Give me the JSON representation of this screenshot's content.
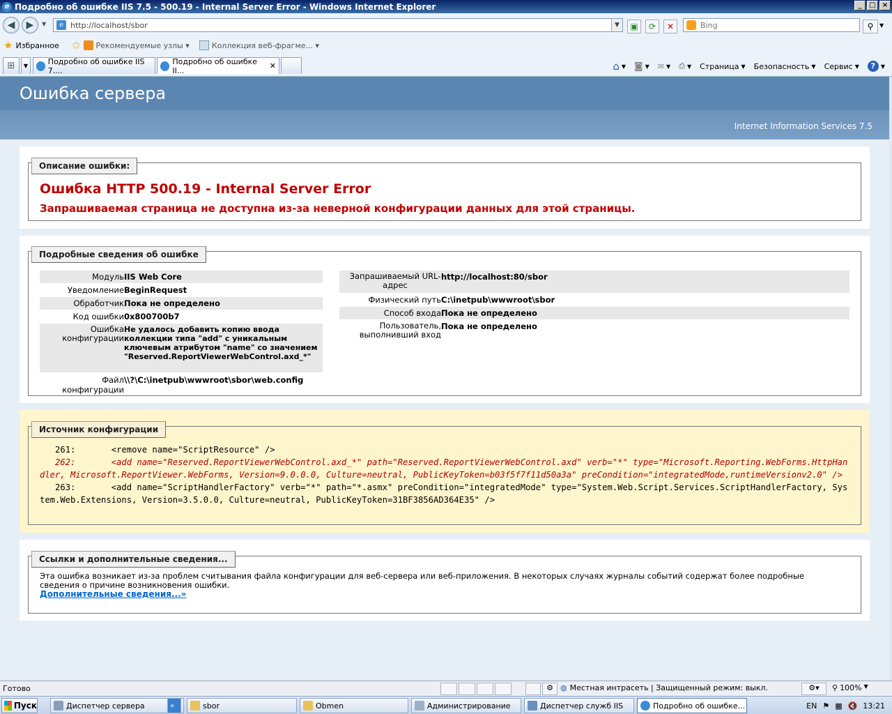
{
  "window": {
    "title": "Подробно об ошибке IIS 7.5 - 500.19 - Internal Server Error - Windows Internet Explorer"
  },
  "toolbar": {
    "address": "http://localhost/sbor",
    "search_placeholder": "Bing"
  },
  "favorites": {
    "label": "Избранное",
    "items": [
      "Рекомендуемые узлы ▾",
      "Коллекция веб-фрагме... ▾"
    ]
  },
  "tabs": [
    {
      "label": "Подробно об ошибке IIS 7...."
    },
    {
      "label": "Подробно об ошибке II..."
    }
  ],
  "commands": {
    "page": "Страница",
    "security": "Безопасность",
    "service": "Сервис"
  },
  "header": {
    "title": "Ошибка сервера",
    "product": "Internet Information Services 7.5"
  },
  "description": {
    "legend": "Описание ошибки:",
    "title": "Ошибка HTTP 500.19 - Internal Server Error",
    "message": "Запрашиваемая страница не доступна из-за неверной конфигурации данных для этой страницы."
  },
  "details": {
    "legend": "Подробные сведения об ошибке",
    "left": [
      {
        "key": "Модуль",
        "value": "IIS Web Core"
      },
      {
        "key": "Уведомление",
        "value": "BeginRequest"
      },
      {
        "key": "Обработчик",
        "value": "Пока не определено"
      },
      {
        "key": "Код ошибки",
        "value": "0x800700b7"
      },
      {
        "key": "Ошибка конфигурации",
        "value": "Не удалось добавить копию ввода коллекции типа \"add\" с уникальным ключевым атрибутом \"name\" со значением \"Reserved.ReportViewerWebControl.axd_*\""
      },
      {
        "key": "Файл конфигурации",
        "value": "\\\\?\\C:\\inetpub\\wwwroot\\sbor\\web.config"
      }
    ],
    "right": [
      {
        "key": "Запрашиваемый URL-адрес",
        "value": "http://localhost:80/sbor"
      },
      {
        "key": "Физический путь",
        "value": "C:\\inetpub\\wwwroot\\sbor"
      },
      {
        "key": "Способ входа",
        "value": "Пока не определено"
      },
      {
        "key": "Пользователь, выполнивший вход",
        "value": "Пока не определено"
      }
    ]
  },
  "source": {
    "legend": "Источник конфигурации",
    "line261": "   261:       <remove name=\"ScriptResource\" />",
    "line262": "   262:       <add name=\"Reserved.ReportViewerWebControl.axd_*\" path=\"Reserved.ReportViewerWebControl.axd\" verb=\"*\" type=\"Microsoft.Reporting.WebForms.HttpHandler, Microsoft.ReportViewer.WebForms, Version=9.0.0.0, Culture=neutral, PublicKeyToken=b03f5f7f11d50a3a\" preCondition=\"integratedMode,runtimeVersionv2.0\" />",
    "line263": "   263:       <add name=\"ScriptHandlerFactory\" verb=\"*\" path=\"*.asmx\" preCondition=\"integratedMode\" type=\"System.Web.Script.Services.ScriptHandlerFactory, System.Web.Extensions, Version=3.5.0.0, Culture=neutral, PublicKeyToken=31BF3856AD364E35\" />"
  },
  "links": {
    "legend": "Ссылки и дополнительные сведения...",
    "text": "Эта ошибка возникает из-за проблем считывания файла конфигурации для веб-сервера или веб-приложения. В некоторых случаях журналы событий содержат более подробные сведения о причине возникновения ошибки.",
    "more": "Дополнительные сведения...»"
  },
  "status": {
    "ready": "Готово",
    "zone": "Местная интрасеть | Защищенный режим: выкл.",
    "zoom": "100%"
  },
  "taskbar": {
    "start": "Пуск",
    "items": [
      "Диспетчер сервера",
      "sbor",
      "Obmen",
      "Администрирование",
      "Диспетчер служб IIS",
      "Подробно об ошибке..."
    ],
    "lang": "EN",
    "time": "13:21"
  }
}
